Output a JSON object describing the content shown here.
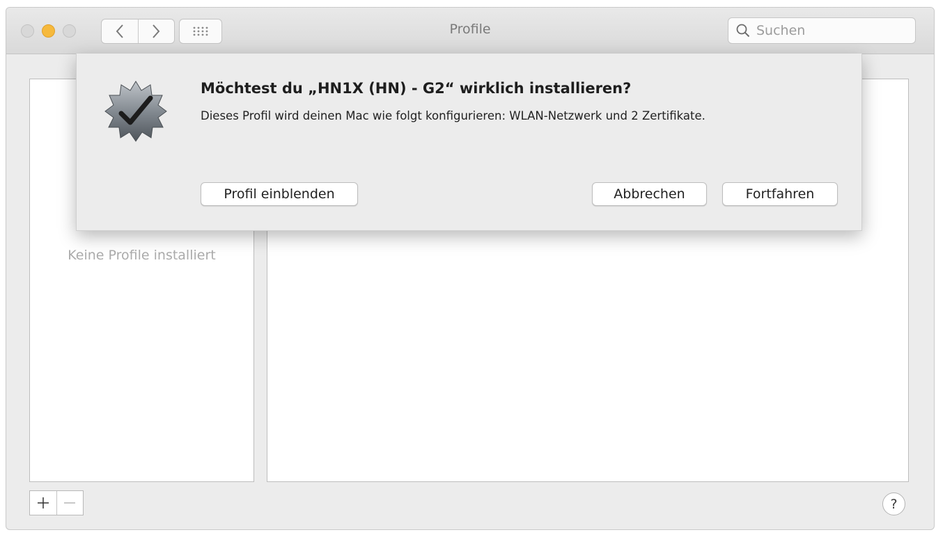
{
  "window": {
    "title": "Profile"
  },
  "search": {
    "placeholder": "Suchen",
    "value": ""
  },
  "sidebar": {
    "empty_label": "Keine Profile installiert"
  },
  "toolbar": {
    "add_label": "+",
    "remove_label": "−",
    "help_label": "?"
  },
  "dialog": {
    "title": "Möchtest du „HN1X (HN) - G2“ wirklich installieren?",
    "message": "Dieses Profil wird deinen Mac wie folgt konfigurieren: WLAN-Netzwerk und 2 Zertifikate.",
    "buttons": {
      "show_profile": "Profil einblenden",
      "cancel": "Abbrechen",
      "continue": "Fortfahren"
    }
  },
  "icons": {
    "traffic_close": "close-icon",
    "traffic_minimize": "minimize-icon",
    "traffic_zoom": "zoom-icon",
    "back": "chevron-left-icon",
    "forward": "chevron-right-icon",
    "grid": "grid-icon",
    "search": "search-icon",
    "badge": "checkmark-badge-icon"
  },
  "colors": {
    "minimize": "#f6b93c",
    "window_bg": "#ececec"
  }
}
